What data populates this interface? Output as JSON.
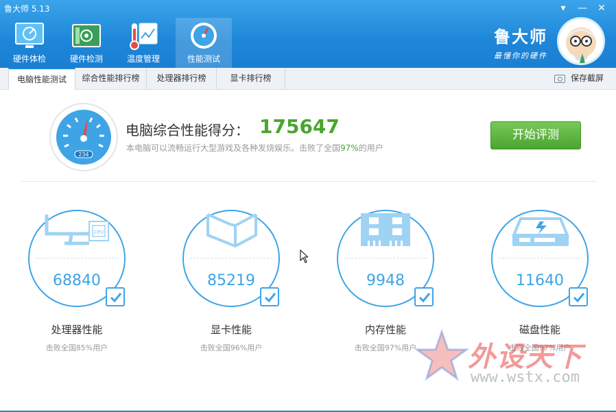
{
  "window": {
    "title": "鲁大师 5.13",
    "menu_icon": "menu-icon",
    "minimize_icon": "minimize-icon",
    "close_icon": "close-icon"
  },
  "nav": {
    "items": [
      {
        "label": "硬件体检",
        "icon": "monitor-check-icon",
        "active": false
      },
      {
        "label": "硬件检测",
        "icon": "circuit-board-icon",
        "active": false
      },
      {
        "label": "温度管理",
        "icon": "thermometer-icon",
        "active": false
      },
      {
        "label": "性能测试",
        "icon": "speedometer-icon",
        "active": true
      }
    ]
  },
  "brand": {
    "name": "鲁大师",
    "slogan": "最懂你的硬件"
  },
  "tabs": [
    {
      "label": "电脑性能测试",
      "active": true
    },
    {
      "label": "综合性能排行榜",
      "active": false
    },
    {
      "label": "处理器排行榜",
      "active": false
    },
    {
      "label": "显卡排行榜",
      "active": false
    }
  ],
  "screenshot_label": "保存截屏",
  "score": {
    "title": "电脑综合性能得分：",
    "value": "175647",
    "desc_prefix": "本电脑可以流畅运行大型游戏及各种发烧娱乐。击败了全国",
    "desc_pct": "97%",
    "desc_suffix": "的用户",
    "gauge_readout": "234"
  },
  "start_button": "开始评测",
  "components": [
    {
      "name": "处理器性能",
      "value": "68840",
      "beat": "击败全国85%用户",
      "icon": "cpu-monitor-icon",
      "chip_label": "CPU"
    },
    {
      "name": "显卡性能",
      "value": "85219",
      "beat": "击败全国96%用户",
      "icon": "cube-icon"
    },
    {
      "name": "内存性能",
      "value": "9948",
      "beat": "击败全国97%用户",
      "icon": "memory-module-icon"
    },
    {
      "name": "磁盘性能",
      "value": "11640",
      "beat": "击败全国97%用户",
      "icon": "hard-disk-icon"
    }
  ],
  "watermark": {
    "text": "外设天下",
    "url": "www.wstx.com"
  },
  "colors": {
    "accent": "#1e86d8",
    "score_green": "#4aa52e",
    "ring_blue": "#3ea4e6"
  }
}
